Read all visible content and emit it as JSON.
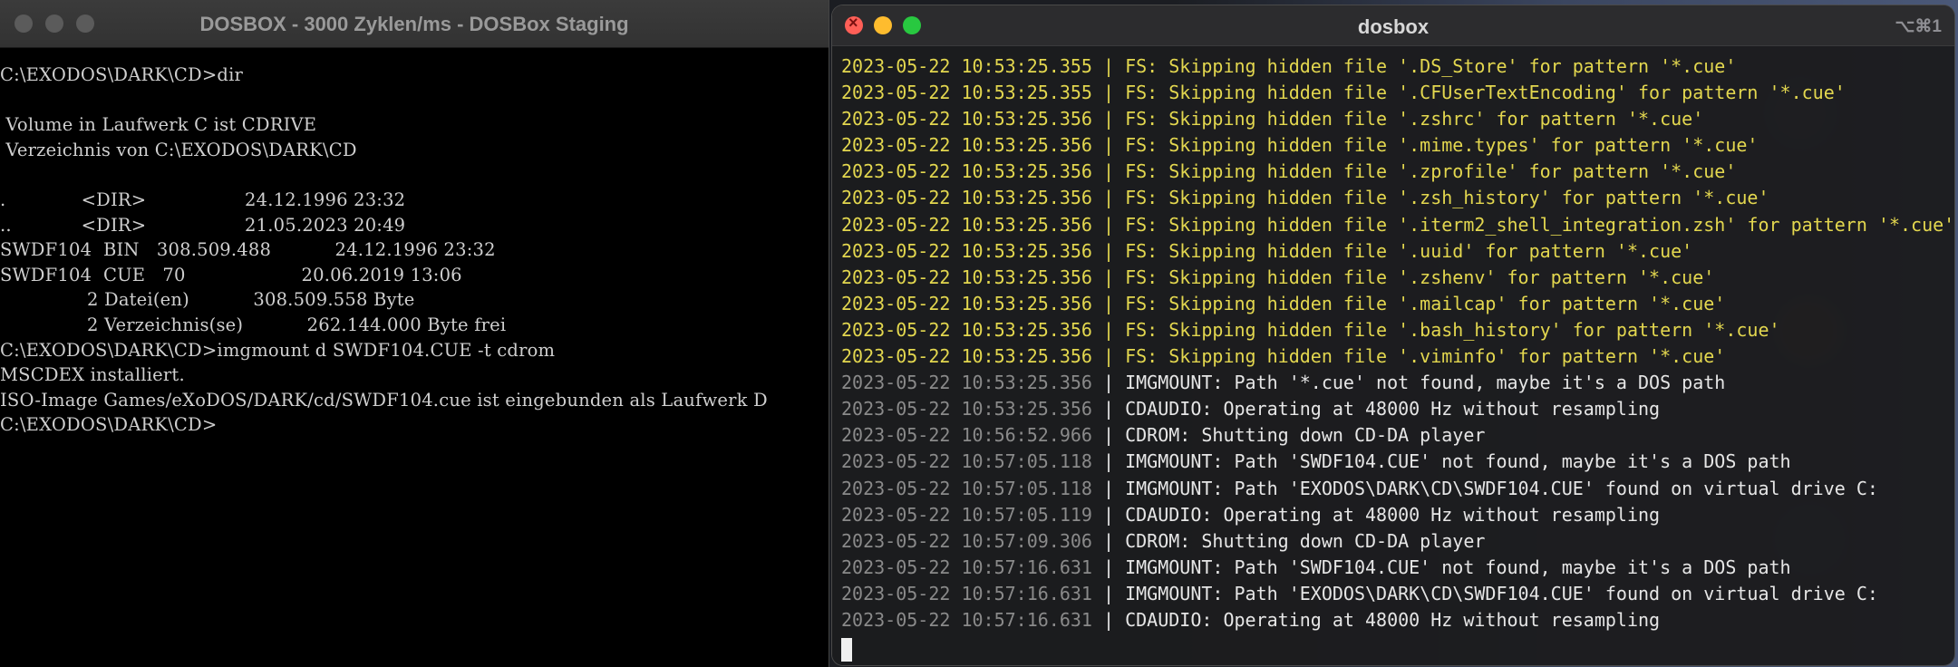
{
  "dosbox": {
    "title": "DOSBOX - 3000 Zyklen/ms - DOSBox Staging",
    "lines": [
      "C:\\EXODOS\\DARK\\CD>dir",
      "",
      " Volume in Laufwerk C ist CDRIVE",
      " Verzeichnis von C:\\EXODOS\\DARK\\CD",
      "",
      ".             <DIR>                 24.12.1996 23:32",
      "..            <DIR>                 21.05.2023 20:49",
      "SWDF104  BIN   308.509.488           24.12.1996 23:32",
      "SWDF104  CUE   70                    20.06.2019 13:06",
      "               2 Datei(en)           308.509.558 Byte",
      "               2 Verzeichnis(se)           262.144.000 Byte frei",
      "C:\\EXODOS\\DARK\\CD>imgmount d SWDF104.CUE -t cdrom",
      "MSCDEX installiert.",
      "ISO-Image Games/eXoDOS/DARK/cd/SWDF104.cue ist eingebunden als Laufwerk D",
      "C:\\EXODOS\\DARK\\CD>"
    ]
  },
  "terminal": {
    "title": "dosbox",
    "shortcut": "⌥⌘1",
    "colors": {
      "warning": "#e3d74f",
      "timestamp_dim": "#8a8a8a",
      "info": "#e6e6e6"
    },
    "log": [
      {
        "ts": "2023-05-22 10:53:25.355",
        "msg": "FS: Skipping hidden file '.DS_Store' for pattern '*.cue'",
        "level": "warn"
      },
      {
        "ts": "2023-05-22 10:53:25.355",
        "msg": "FS: Skipping hidden file '.CFUserTextEncoding' for pattern '*.cue'",
        "level": "warn"
      },
      {
        "ts": "2023-05-22 10:53:25.356",
        "msg": "FS: Skipping hidden file '.zshrc' for pattern '*.cue'",
        "level": "warn"
      },
      {
        "ts": "2023-05-22 10:53:25.356",
        "msg": "FS: Skipping hidden file '.mime.types' for pattern '*.cue'",
        "level": "warn"
      },
      {
        "ts": "2023-05-22 10:53:25.356",
        "msg": "FS: Skipping hidden file '.zprofile' for pattern '*.cue'",
        "level": "warn"
      },
      {
        "ts": "2023-05-22 10:53:25.356",
        "msg": "FS: Skipping hidden file '.zsh_history' for pattern '*.cue'",
        "level": "warn"
      },
      {
        "ts": "2023-05-22 10:53:25.356",
        "msg": "FS: Skipping hidden file '.iterm2_shell_integration.zsh' for pattern '*.cue'",
        "level": "warn"
      },
      {
        "ts": "2023-05-22 10:53:25.356",
        "msg": "FS: Skipping hidden file '.uuid' for pattern '*.cue'",
        "level": "warn"
      },
      {
        "ts": "2023-05-22 10:53:25.356",
        "msg": "FS: Skipping hidden file '.zshenv' for pattern '*.cue'",
        "level": "warn"
      },
      {
        "ts": "2023-05-22 10:53:25.356",
        "msg": "FS: Skipping hidden file '.mailcap' for pattern '*.cue'",
        "level": "warn"
      },
      {
        "ts": "2023-05-22 10:53:25.356",
        "msg": "FS: Skipping hidden file '.bash_history' for pattern '*.cue'",
        "level": "warn"
      },
      {
        "ts": "2023-05-22 10:53:25.356",
        "msg": "FS: Skipping hidden file '.viminfo' for pattern '*.cue'",
        "level": "warn"
      },
      {
        "ts": "2023-05-22 10:53:25.356",
        "msg": "IMGMOUNT: Path '*.cue' not found, maybe it's a DOS path",
        "level": "info"
      },
      {
        "ts": "2023-05-22 10:53:25.356",
        "msg": "CDAUDIO: Operating at 48000 Hz without resampling",
        "level": "info"
      },
      {
        "ts": "2023-05-22 10:56:52.966",
        "msg": "CDROM: Shutting down CD-DA player",
        "level": "info"
      },
      {
        "ts": "2023-05-22 10:57:05.118",
        "msg": "IMGMOUNT: Path 'SWDF104.CUE' not found, maybe it's a DOS path",
        "level": "info"
      },
      {
        "ts": "2023-05-22 10:57:05.118",
        "msg": "IMGMOUNT: Path 'EXODOS\\DARK\\CD\\SWDF104.CUE' found on virtual drive C:",
        "level": "info"
      },
      {
        "ts": "2023-05-22 10:57:05.119",
        "msg": "CDAUDIO: Operating at 48000 Hz without resampling",
        "level": "info"
      },
      {
        "ts": "2023-05-22 10:57:09.306",
        "msg": "CDROM: Shutting down CD-DA player",
        "level": "info"
      },
      {
        "ts": "2023-05-22 10:57:16.631",
        "msg": "IMGMOUNT: Path 'SWDF104.CUE' not found, maybe it's a DOS path",
        "level": "info"
      },
      {
        "ts": "2023-05-22 10:57:16.631",
        "msg": "IMGMOUNT: Path 'EXODOS\\DARK\\CD\\SWDF104.CUE' found on virtual drive C:",
        "level": "info"
      },
      {
        "ts": "2023-05-22 10:57:16.631",
        "msg": "CDAUDIO: Operating at 48000 Hz without resampling",
        "level": "info"
      }
    ],
    "separator": " | "
  }
}
